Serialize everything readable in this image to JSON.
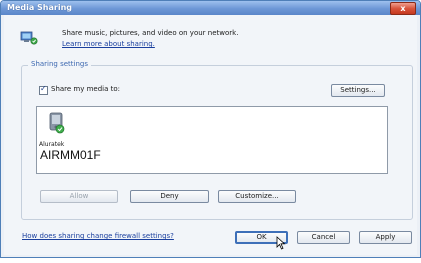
{
  "window": {
    "title": "Media Sharing",
    "close_glyph": "x"
  },
  "intro": {
    "text": "Share music, pictures, and video on your network.",
    "learn_link": "Learn more about sharing."
  },
  "sharing_settings": {
    "group_label": "Sharing settings",
    "share_checkbox_label": "Share my media to:",
    "share_checked": true,
    "settings_button": "Settings..."
  },
  "devices": [
    {
      "name": "Aluratek",
      "id": "AIRMM01F",
      "icon": "media-device-icon"
    }
  ],
  "device_buttons": {
    "allow": "Allow",
    "deny": "Deny",
    "customize": "Customize..."
  },
  "footer": {
    "firewall_link": "How does sharing change firewall settings?",
    "ok": "OK",
    "cancel": "Cancel",
    "apply": "Apply"
  },
  "colors": {
    "titlebar": "#6d97d6",
    "link": "#1a3f9e",
    "group_label": "#3d68b0",
    "close_button": "#d8543c"
  }
}
